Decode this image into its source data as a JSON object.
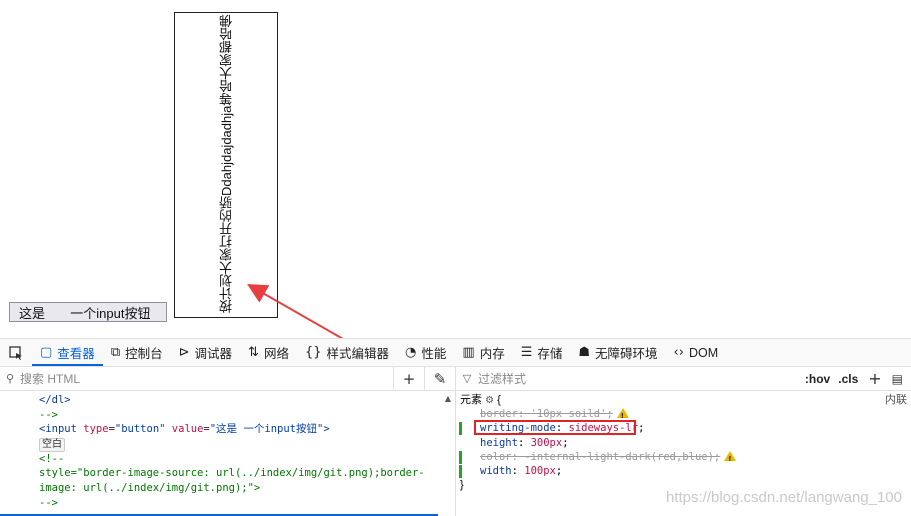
{
  "page": {
    "vertical_text": "按计划大家打开的骄Ddahjdajdadhja等哈大家都哈佛",
    "input_button_value": "这是       一个input按钮"
  },
  "devtools": {
    "pick_icon": "element-picker-icon",
    "tabs": [
      {
        "label": "查看器",
        "icon": "inspector-icon"
      },
      {
        "label": "控制台",
        "icon": "console-icon"
      },
      {
        "label": "调试器",
        "icon": "debugger-icon"
      },
      {
        "label": "网络",
        "icon": "network-icon"
      },
      {
        "label": "样式编辑器",
        "icon": "style-editor-icon"
      },
      {
        "label": "性能",
        "icon": "performance-icon"
      },
      {
        "label": "内存",
        "icon": "memory-icon"
      },
      {
        "label": "存储",
        "icon": "storage-icon"
      },
      {
        "label": "无障碍环境",
        "icon": "accessibility-icon"
      },
      {
        "label": "DOM",
        "icon": "dom-icon"
      }
    ],
    "html_search_placeholder": "搜索 HTML",
    "html_lines": {
      "l1_close_dl": "</dl>",
      "l2_comment_end": "-->",
      "l3_input_tag_open": "<input ",
      "l3_attr_type": "type",
      "l3_val_type": "\"button\"",
      "l3_attr_value": "value",
      "l3_val_value": "\"这是 一个input按钮\"",
      "l3_tag_close": ">",
      "whitespace_badge": "空白",
      "l5_comment_start": "<!--",
      "l6_comment": "style=\"border-image-source: url(../index/img/git.png);border-",
      "l7_comment": "image: url(../index/img/git.png);\">",
      "l8_comment_end": "-->"
    },
    "rules_filter_placeholder": "过滤样式",
    "hov_label": ":hov",
    "cls_label": ".cls",
    "rules": {
      "element_label": "元素",
      "open_brace": "{",
      "inline_label": "内联",
      "r1_prop": "border",
      "r1_val": "'10px soild'",
      "r2_prop": "writing-mode",
      "r2_val": "sideways-lr",
      "r3_prop": "height",
      "r3_val": "300px",
      "r4_prop": "color",
      "r4_val": "-internal-light-dark(red,blue)",
      "r5_prop": "width",
      "r5_val": "100px",
      "close_brace": "}"
    },
    "colors": {
      "accent": "#0a64d6",
      "highlight_box": "#e02424",
      "arrow": "#e84040",
      "warning": "#e8b800",
      "changed_marker": "#2aa031"
    }
  },
  "watermark": "https://blog.csdn.net/langwang_100"
}
